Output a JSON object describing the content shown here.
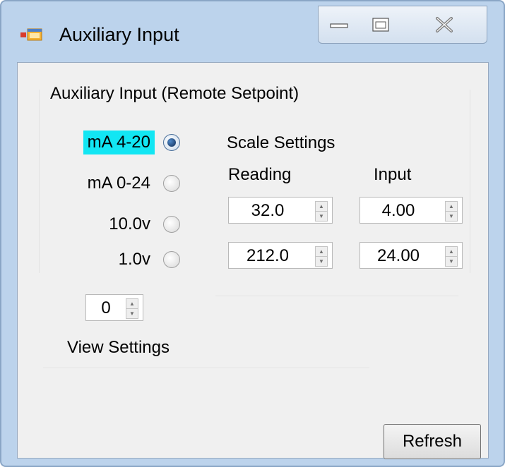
{
  "window": {
    "title": "Auxiliary Input"
  },
  "group": {
    "title": "Auxiliary Input (Remote Setpoint)"
  },
  "input_types": [
    {
      "label": "mA 4-20",
      "selected": true
    },
    {
      "label": "mA 0-24",
      "selected": false
    },
    {
      "label": "10.0v",
      "selected": false
    },
    {
      "label": "1.0v",
      "selected": false
    }
  ],
  "view": {
    "value": "0",
    "label": "View Settings"
  },
  "scale": {
    "title": "Scale Settings",
    "reading_header": "Reading",
    "input_header": "Input",
    "rows": [
      {
        "reading": "32.0",
        "input": "4.00"
      },
      {
        "reading": "212.0",
        "input": "24.00"
      }
    ]
  },
  "buttons": {
    "refresh": "Refresh"
  },
  "colors": {
    "selected_highlight": "#12e6f3"
  }
}
